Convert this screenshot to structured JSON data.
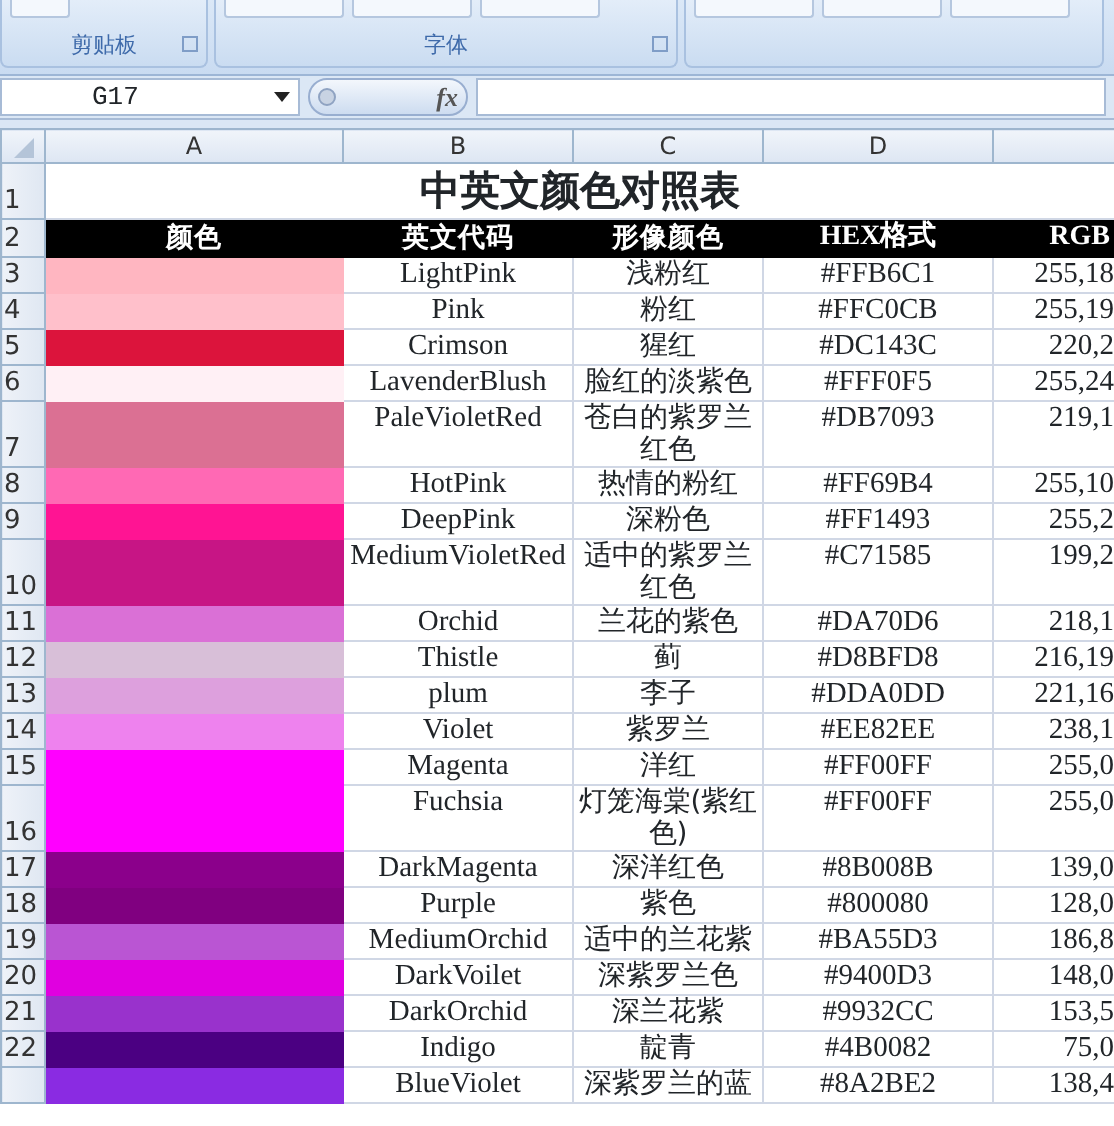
{
  "ribbon": {
    "groups": [
      {
        "label": "剪贴板"
      },
      {
        "label": "字体"
      }
    ]
  },
  "formula_bar": {
    "name_box": "G17",
    "function_label": "fx"
  },
  "columns": [
    "A",
    "B",
    "C",
    "D"
  ],
  "title_row": {
    "row_number": "1",
    "title": "中英文颜色对照表"
  },
  "header_row": {
    "row_number": "2",
    "headers": [
      "颜色",
      "英文代码",
      "形像颜色",
      "HEX格式",
      "RGB"
    ]
  },
  "rows": [
    {
      "row_number": "3",
      "color": "#ffb6c1",
      "english": "LightPink",
      "chinese": "浅粉红",
      "hex": "#FFB6C1",
      "rgb": "255,18"
    },
    {
      "row_number": "4",
      "color": "#ffc0cb",
      "english": "Pink",
      "chinese": "粉红",
      "hex": "#FFC0CB",
      "rgb": "255,19"
    },
    {
      "row_number": "5",
      "color": "#dc143c",
      "english": "Crimson",
      "chinese": "猩红",
      "hex": "#DC143C",
      "rgb": "220,2"
    },
    {
      "row_number": "6",
      "color": "#fff0f5",
      "english": "LavenderBlush",
      "chinese": "脸红的淡紫色",
      "hex": "#FFF0F5",
      "rgb": "255,24"
    },
    {
      "row_number": "7",
      "color": "#db7093",
      "english": "PaleVioletRed",
      "chinese": "苍白的紫罗兰红色",
      "hex": "#DB7093",
      "rgb": "219,1"
    },
    {
      "row_number": "8",
      "color": "#ff69b4",
      "english": "HotPink",
      "chinese": "热情的粉红",
      "hex": "#FF69B4",
      "rgb": "255,10"
    },
    {
      "row_number": "9",
      "color": "#ff1493",
      "english": "DeepPink",
      "chinese": "深粉色",
      "hex": "#FF1493",
      "rgb": "255,2"
    },
    {
      "row_number": "10",
      "color": "#c71585",
      "english": "MediumVioletRed",
      "chinese": "适中的紫罗兰红色",
      "hex": "#C71585",
      "rgb": "199,2"
    },
    {
      "row_number": "11",
      "color": "#da70d6",
      "english": "Orchid",
      "chinese": "兰花的紫色",
      "hex": "#DA70D6",
      "rgb": "218,1"
    },
    {
      "row_number": "12",
      "color": "#d8bfd8",
      "english": "Thistle",
      "chinese": "蓟",
      "hex": "#D8BFD8",
      "rgb": "216,19"
    },
    {
      "row_number": "13",
      "color": "#dda0dd",
      "english": "plum",
      "chinese": "李子",
      "hex": "#DDA0DD",
      "rgb": "221,16"
    },
    {
      "row_number": "14",
      "color": "#ee82ee",
      "english": "Violet",
      "chinese": "紫罗兰",
      "hex": "#EE82EE",
      "rgb": "238,1"
    },
    {
      "row_number": "15",
      "color": "#ff00ff",
      "english": "Magenta",
      "chinese": "洋红",
      "hex": "#FF00FF",
      "rgb": "255,0"
    },
    {
      "row_number": "16",
      "color": "#ff00ff",
      "english": "Fuchsia",
      "chinese": "灯笼海棠(紫红色)",
      "hex": "#FF00FF",
      "rgb": "255,0"
    },
    {
      "row_number": "17",
      "color": "#8b008b",
      "english": "DarkMagenta",
      "chinese": "深洋红色",
      "hex": "#8B008B",
      "rgb": "139,0"
    },
    {
      "row_number": "18",
      "color": "#800080",
      "english": "Purple",
      "chinese": "紫色",
      "hex": "#800080",
      "rgb": "128,0"
    },
    {
      "row_number": "19",
      "color": "#ba55d3",
      "english": "MediumOrchid",
      "chinese": "适中的兰花紫",
      "hex": "#BA55D3",
      "rgb": "186,8"
    },
    {
      "row_number": "20",
      "color": "#e000e0",
      "english": "DarkVoilet",
      "chinese": "深紫罗兰色",
      "hex": "#9400D3",
      "rgb": "148,0"
    },
    {
      "row_number": "21",
      "color": "#9932cc",
      "english": "DarkOrchid",
      "chinese": "深兰花紫",
      "hex": "#9932CC",
      "rgb": "153,5"
    },
    {
      "row_number": "22",
      "color": "#4b0082",
      "english": "Indigo",
      "chinese": "靛青",
      "hex": "#4B0082",
      "rgb": "75,0"
    },
    {
      "color": "#8a2be2",
      "english": "BlueViolet",
      "chinese": "深紫罗兰的蓝",
      "hex": "#8A2BE2",
      "rgb": "138,4"
    }
  ]
}
